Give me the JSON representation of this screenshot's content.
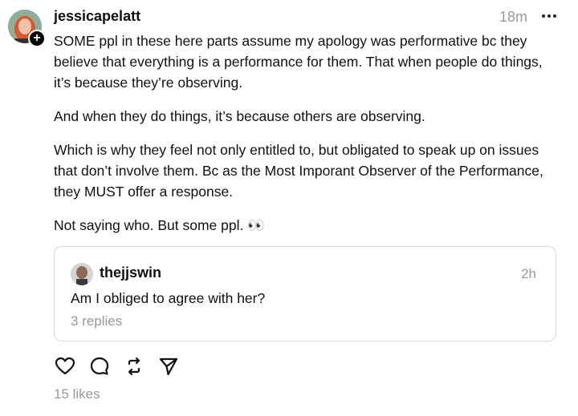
{
  "post": {
    "username": "jessicapelatt",
    "time": "18m",
    "paragraphs": [
      "SOME ppl in these here parts assume my apology was performative bc they believe that everything is a performance for them. That when people do things, it’s because they’re observing.",
      "And when they do things, it’s because others are observing.",
      "Which is why they feel not only entitled to, but obligated to speak up on issues that don’t involve them. Bc as the Most Imporant Observer of the Performance, they MUST offer a response.",
      "Not saying who. But some ppl. 👀"
    ],
    "likes": "15 likes"
  },
  "quoted": {
    "username": "thejjswin",
    "time": "2h",
    "text": "Am I obliged to agree with her?",
    "replies": "3 replies"
  },
  "icons": {
    "avatar_badge": "plus-icon",
    "more": "more-horizontal-icon",
    "like": "heart-icon",
    "reply": "comment-icon",
    "repost": "repost-icon",
    "share": "send-icon"
  },
  "colors": {
    "muted": "#999999",
    "text": "#101010",
    "border": "#d9d9d9"
  }
}
